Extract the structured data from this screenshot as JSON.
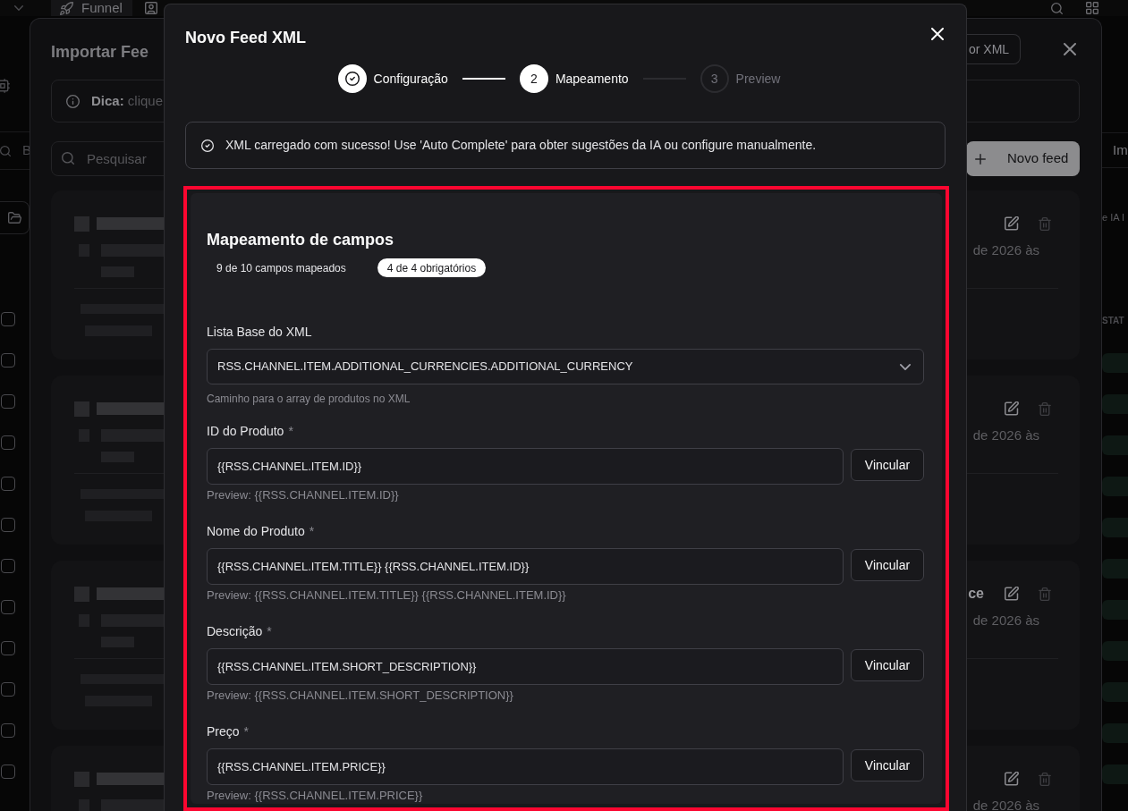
{
  "app": {
    "tabs": [
      {
        "label": "Funnel",
        "selected": true
      }
    ],
    "sidebar_search": {
      "placeholder": "B"
    },
    "row_checkboxes": [
      {
        "checked": false
      },
      {
        "checked": false
      },
      {
        "checked": false
      },
      {
        "checked": false
      },
      {
        "checked": false
      },
      {
        "checked": false
      },
      {
        "checked": false
      },
      {
        "checked": false
      },
      {
        "checked": false
      },
      {
        "checked": false
      },
      {
        "checked": false
      },
      {
        "checked": false
      }
    ],
    "side_tab": {
      "label": "Im"
    },
    "side_text": "e IA I",
    "column_header": "STAT"
  },
  "import_dialog": {
    "title": "Importar Fee",
    "xml_button": "or XML",
    "tip": "**Dica:** clique",
    "search": {
      "placeholder": "Pesquisar"
    },
    "new_button": "Novo feed",
    "feeds": [
      {
        "date": "de 2026 às"
      },
      {
        "date": "de 2026 às"
      },
      {
        "title": "ce",
        "date": "de 2026 às"
      },
      {
        "date": "de 2026 às"
      }
    ]
  },
  "dialog": {
    "title": "Novo Feed XML",
    "steps": [
      {
        "label": "Configuração",
        "done": true,
        "selected": false
      },
      {
        "label": "Mapeamento",
        "number": "2",
        "done": false,
        "selected": true
      },
      {
        "label": "Preview",
        "number": "3",
        "done": false,
        "selected": false
      }
    ],
    "alert": "XML carregado com sucesso! Use 'Auto Complete' para obter sugestões da IA ou configure manualmente.",
    "mapping": {
      "title": "Mapeamento de campos",
      "badges": [
        {
          "text": "9 de 10 campos mapeados",
          "kind": "plain"
        },
        {
          "text": "4 de 4 obrigatórios",
          "kind": "filled"
        }
      ],
      "base_list": {
        "label": "Lista Base do XML",
        "value": "RSS.CHANNEL.ITEM.ADDITIONAL_CURRENCIES.ADDITIONAL_CURRENCY",
        "hint": "Caminho para o array de produtos no XML"
      },
      "fields": [
        {
          "label": "ID do Produto",
          "required_mark": "*",
          "value": "{{RSS.CHANNEL.ITEM.ID}}",
          "button": "Vincular",
          "preview": "Preview: {{RSS.CHANNEL.ITEM.ID}}"
        },
        {
          "label": "Nome do Produto",
          "required_mark": "*",
          "value": "{{RSS.CHANNEL.ITEM.TITLE}} {{RSS.CHANNEL.ITEM.ID}}",
          "button": "Vincular",
          "preview": "Preview: {{RSS.CHANNEL.ITEM.TITLE}} {{RSS.CHANNEL.ITEM.ID}}"
        },
        {
          "label": "Descrição",
          "required_mark": "*",
          "value": "{{RSS.CHANNEL.ITEM.SHORT_DESCRIPTION}}",
          "button": "Vincular",
          "preview": "Preview: {{RSS.CHANNEL.ITEM.SHORT_DESCRIPTION}}"
        },
        {
          "label": "Preço",
          "required_mark": "*",
          "value": "{{RSS.CHANNEL.ITEM.PRICE}}",
          "button": "Vincular",
          "preview": "Preview: {{RSS.CHANNEL.ITEM.PRICE}}"
        }
      ]
    }
  }
}
